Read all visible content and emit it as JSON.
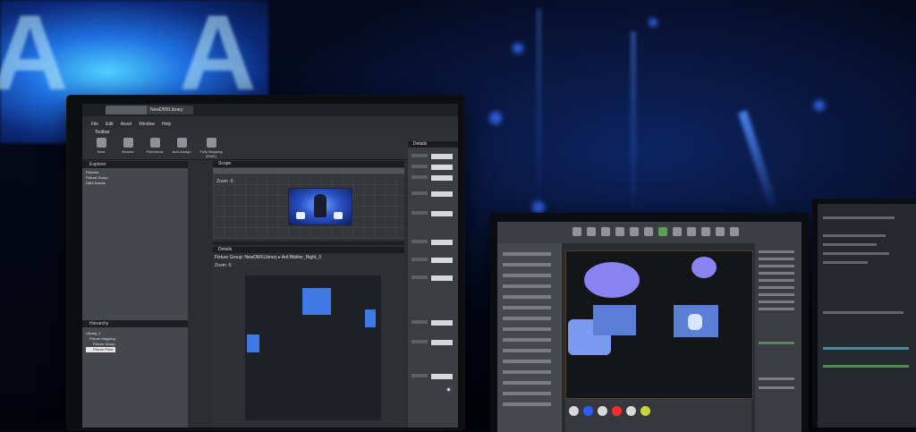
{
  "main_app": {
    "tabs": [
      "",
      "NewDMXLibrary"
    ],
    "menu": [
      "File",
      "Edit",
      "Asset",
      "Window",
      "Help"
    ],
    "toolbar": {
      "title": "Toolbar",
      "buttons": [
        "Save",
        "Browse",
        "Patchbook",
        "Auto Assign",
        "Fully Mapping (DMX)"
      ]
    },
    "explorer": {
      "header": "Explorer",
      "items": [
        "Fixtures",
        "Fixture Group",
        "DMX Assets"
      ]
    },
    "hierarchy": {
      "header": "Hierarchy",
      "items": [
        "Library_1",
        "Fixture Mapping",
        "Fixture Group",
        "Fixture Point"
      ]
    },
    "scope": {
      "header": "Scope",
      "zoom": "Zoom -5"
    },
    "fixture_panel": {
      "header": "Details",
      "path": "Fixture Group: NewDMXLibrary ▸ Ard Bibilier_Right_3",
      "zoom": "Zoom -5"
    },
    "details_header": "Details"
  },
  "colors": {
    "accent_blue": "#3f79e6",
    "ellipse_purple": "#8b82f2",
    "swatches": [
      "#d8d8d8",
      "#2d5bff",
      "#d8d8d8",
      "#ff2a2a",
      "#d8d8d8",
      "#c8d43a"
    ]
  }
}
